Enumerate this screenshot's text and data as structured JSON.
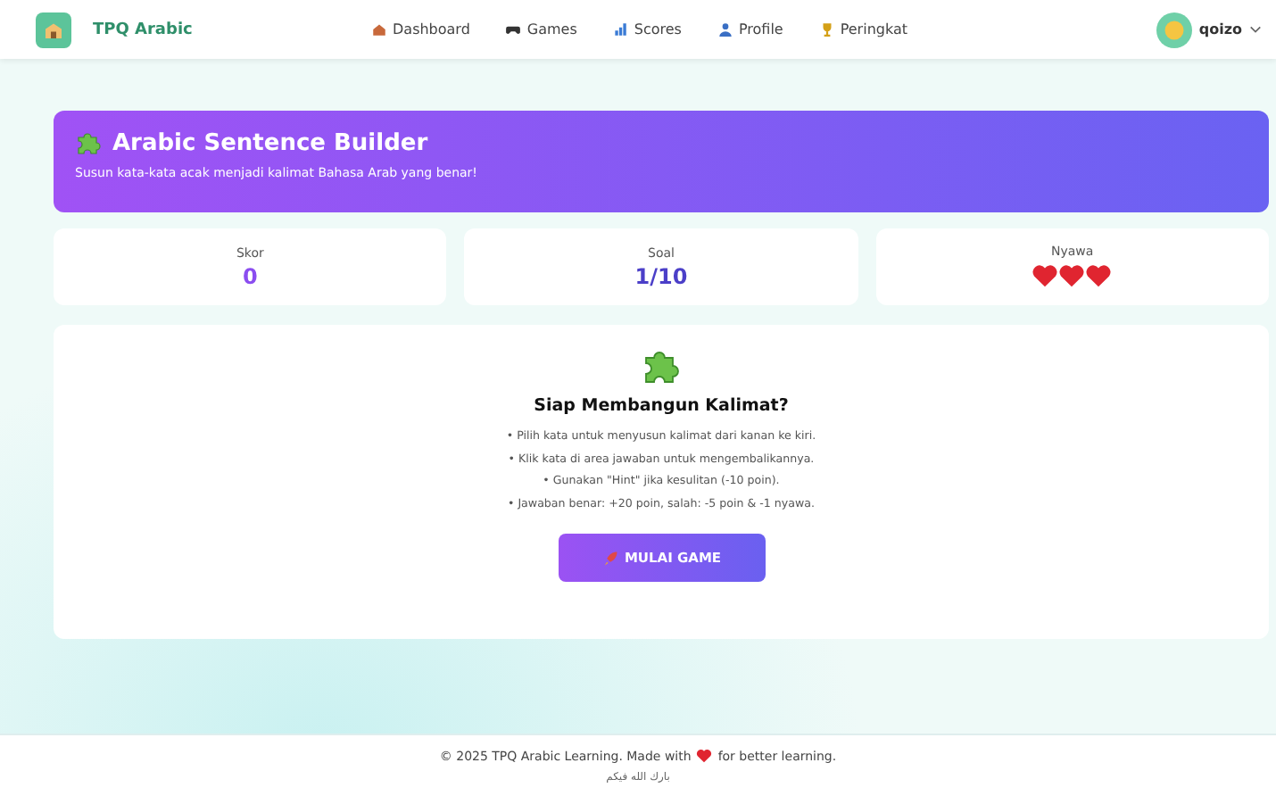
{
  "brand": {
    "name": "TPQ Arabic"
  },
  "nav": [
    {
      "label": "Dashboard",
      "kind": "house"
    },
    {
      "label": "Games",
      "kind": "gamepad"
    },
    {
      "label": "Scores",
      "kind": "chart"
    },
    {
      "label": "Profile",
      "kind": "person"
    },
    {
      "label": "Peringkat",
      "kind": "trophy"
    }
  ],
  "user": {
    "name": "qoizo"
  },
  "hero": {
    "title": "Arabic Sentence Builder",
    "subtitle": "Susun kata-kata acak menjadi kalimat Bahasa Arab yang benar!"
  },
  "stats": [
    {
      "label": "Skor",
      "value": "0",
      "kind": "text"
    },
    {
      "label": "Soal",
      "value": "1/10",
      "kind": "text"
    },
    {
      "label": "Nyawa",
      "kind": "hearts",
      "stars": 3
    }
  ],
  "intro": {
    "title": "Siap Membangun Kalimat?",
    "rules": [
      "• Pilih kata untuk menyusun kalimat dari kanan ke kiri.",
      "• Klik kata di area jawaban untuk mengembalikannya.",
      "• Gunakan \"Hint\" jika kesulitan (-10 poin).",
      "• Jawaban benar: +20 poin, salah: -5 poin & -1 nyawa."
    ],
    "button": "MULAI GAME"
  },
  "footer": {
    "before": "© 2025 TPQ Arabic Learning. Made with",
    "after": "for better learning.",
    "arabic": "بارك الله فيكم"
  }
}
